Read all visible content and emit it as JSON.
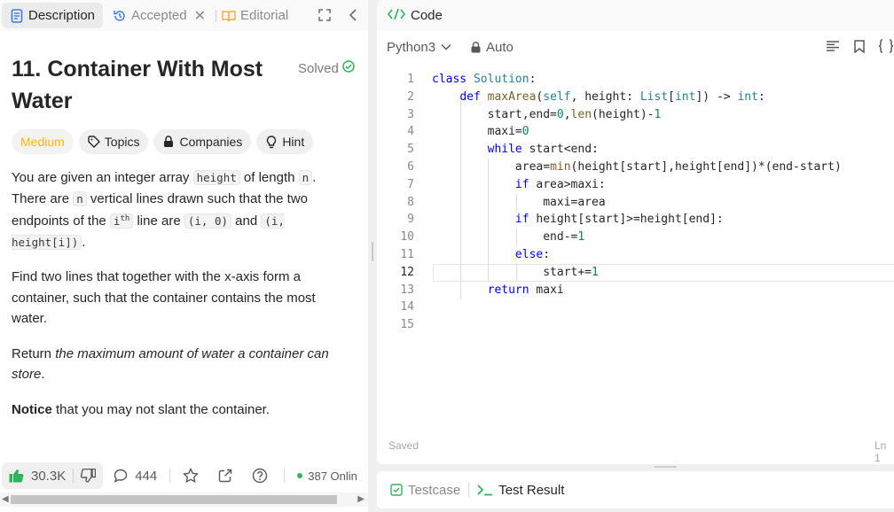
{
  "left_tabs": {
    "description": "Description",
    "accepted": "Accepted",
    "editorial": "Editorial"
  },
  "problem": {
    "title": "11. Container With Most Water",
    "status": "Solved"
  },
  "tags": {
    "difficulty": "Medium",
    "topics": "Topics",
    "companies": "Companies",
    "hint": "Hint"
  },
  "description": {
    "p1_a": "You are given an integer array ",
    "p1_code1": "height",
    "p1_b": " of length ",
    "p1_code2": "n",
    "p1_c": ". There are ",
    "p1_code3": "n",
    "p1_d": " vertical lines drawn such that the two endpoints of the ",
    "p1_code4": "i",
    "p1_sup": "th",
    "p1_e": " line are ",
    "p1_code5": "(i, 0)",
    "p1_f": " and ",
    "p1_code6": "(i, height[i])",
    "p1_g": ".",
    "p2": "Find two lines that together with the x-axis form a container, such that the container contains the most water.",
    "p3_a": "Return ",
    "p3_em": "the maximum amount of water a container can store",
    "p3_b": ".",
    "p4_strong": "Notice",
    "p4_rest": " that you may not slant the container."
  },
  "actions": {
    "likes": "30.3K",
    "comments": "444",
    "online": "387 Onlin"
  },
  "code_panel": {
    "title": "Code",
    "language": "Python3",
    "mode": "Auto",
    "saved": "Saved",
    "cursor": "Ln 1"
  },
  "code_lines": [
    "class Solution:",
    "    def maxArea(self, height: List[int]) -> int:",
    "        start,end=0,len(height)-1",
    "        maxi=0",
    "        while start<end:",
    "            area=min(height[start],height[end])*(end-start)",
    "            if area>maxi:",
    "                maxi=area",
    "            if height[start]>=height[end]:",
    "                end-=1",
    "            else:",
    "                start+=1",
    "        return maxi",
    "",
    ""
  ],
  "bottom_tabs": {
    "testcase": "Testcase",
    "test_result": "Test Result"
  },
  "colors": {
    "medium": "#ffb800",
    "solved": "#2db55d",
    "like": "#2db55d",
    "keyword": "#0000ff",
    "code_green": "#2db55d"
  }
}
